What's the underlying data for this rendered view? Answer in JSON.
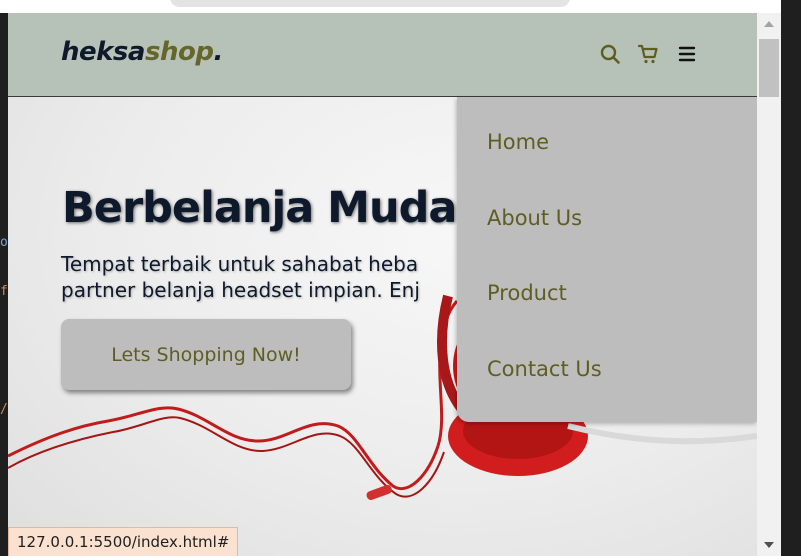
{
  "brand": {
    "part1": "heksa",
    "part2": "shop",
    "part3": "."
  },
  "nav": {
    "icons": [
      "search-icon",
      "cart-icon",
      "hamburger-menu-icon"
    ],
    "menu_items": [
      {
        "label": "Home"
      },
      {
        "label": "About Us"
      },
      {
        "label": "Product"
      },
      {
        "label": "Contact Us"
      }
    ]
  },
  "hero": {
    "title": "Berbelanja Mudah d",
    "subtitle_line1": "Tempat terbaik untuk sahabat heba",
    "subtitle_line2": "partner belanja headset impian. Enj",
    "cta_label": "Lets Shopping Now!"
  },
  "status_bar": {
    "url": "127.0.0.1:5500/index.html#"
  },
  "editor_marks": [
    "o",
    "f",
    "/"
  ],
  "colors": {
    "navbar_bg": "#b6c2b7",
    "brand_dark": "#0e1a2b",
    "brand_olive": "#66662a",
    "menu_bg": "#bdbdbd",
    "menu_text": "#5e5e22"
  }
}
